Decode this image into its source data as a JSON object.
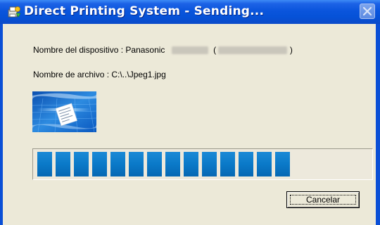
{
  "window": {
    "title": "Direct Printing System - Sending...",
    "title_color": "#0a55dc",
    "close_icon": "close-icon"
  },
  "device": {
    "label": "Nombre del dispositivo : Panasonic",
    "model_redacted": true,
    "open_paren": "(",
    "close_paren": ")"
  },
  "file": {
    "label": "Nombre de archivo : C:\\..\\Jpeg1.jpg"
  },
  "illustration": {
    "icon": "printing-document-illustration"
  },
  "progress": {
    "filled_blocks": 14,
    "total_blocks": 19,
    "fraction": 0.74,
    "color": "#0a79c8"
  },
  "buttons": {
    "cancel_label": "Cancelar"
  }
}
